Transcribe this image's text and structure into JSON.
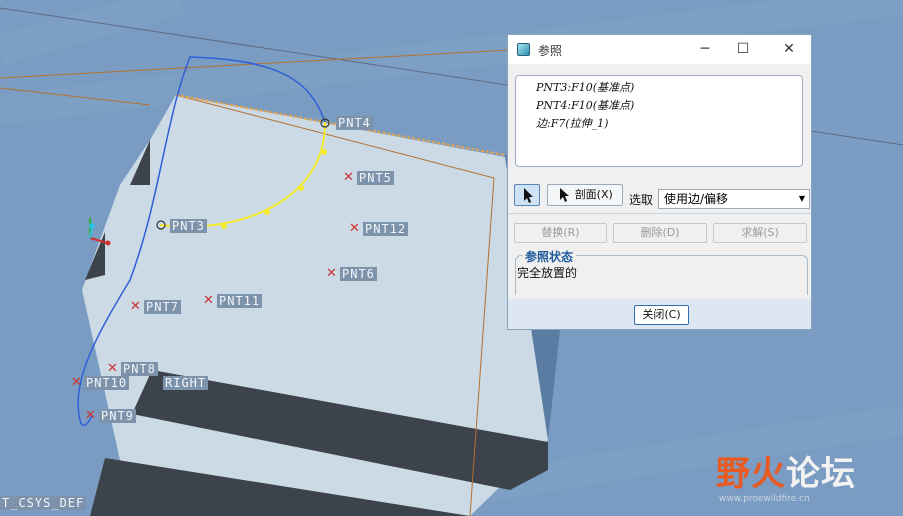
{
  "viewport": {
    "points": [
      "PNT4",
      "PNT5",
      "PNT3",
      "PNT12",
      "PNT6",
      "PNT11",
      "PNT7",
      "PNT8",
      "PNT10",
      "PNT9"
    ],
    "plane_label": "RIGHT",
    "csys_label": "T_CSYS_DEF"
  },
  "dialog": {
    "title": "参照",
    "references": [
      "PNT3:F10(基准点)",
      "PNT4:F10(基准点)",
      "边:F7(拉伸_1)"
    ],
    "section_button": "剖面(X)",
    "choose_label": "选取",
    "mode_select": "使用边/偏移",
    "replace_button": "替换(R)",
    "delete_button": "删除(D)",
    "solve_button": "求解(S)",
    "status_title": "参照状态",
    "status_text": "完全放置的",
    "close_button": "关闭(C)"
  },
  "watermark": {
    "text_part1": "野火",
    "text_part2": "论坛",
    "url": "www.proewildfire.cn"
  },
  "colors": {
    "background": "#7a9cc2",
    "part_face": "#ccdae6",
    "part_shadow": "#3c434a",
    "spline": "#f2ea2a",
    "curve": "#2f5fd8",
    "dialog_accent": "#1f5c9c"
  }
}
